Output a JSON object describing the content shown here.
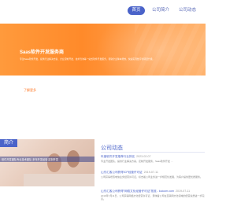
{
  "nav": {
    "items": [
      {
        "label": "首页",
        "active": true
      },
      {
        "label": "公司简介",
        "active": false
      },
      {
        "label": "公司动态",
        "active": false
      }
    ]
  },
  "banner": {
    "title": "Saas软件开发服务商",
    "desc": "专注Saas软件开发，提供行业解决方案、企业定制开发、技术咨询等一站式软件开发服务，帮助企业降本增效，快速实现数字化转型升级。"
  },
  "more_link": "了解更多",
  "image_card": {
    "tag": "简介",
    "caption": "软件开发团队专业技术团队 多年开发经验 定制开发"
  },
  "news": {
    "title": "公司动态",
    "items": [
      {
        "head": "年度软件开发推荐行业排名",
        "date": "2023-02-07",
        "body": "专业开发团队，提供行业解决方案，定制开发服务，Saas软件开发 …"
      },
      {
        "head": "山东汇客公司获得ICP经营许可证",
        "date": "2019-07-11",
        "body": "公司获得增值电信业务经营许可证，标志着公司业务进一步规范化发展，为客户提供更优质服务。"
      },
      {
        "head": "山东汇客公司获得“网络文化经营许可证”批准 - kuicom.com",
        "date": "2019-07-11",
        "body": "2019年7月11日，公司获得网络文化经营许可证，意味着公司在互联网文化领域的经营资质进一步完善。"
      }
    ]
  }
}
